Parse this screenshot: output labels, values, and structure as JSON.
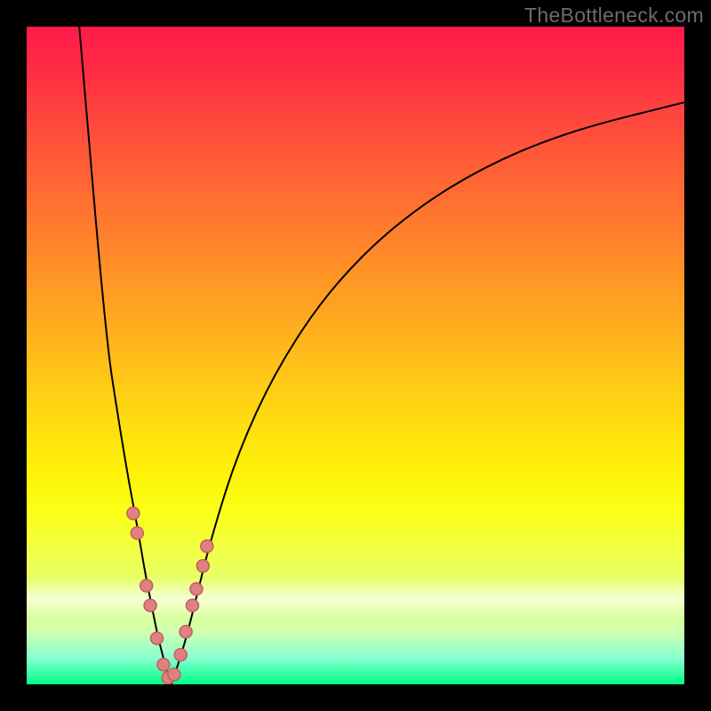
{
  "watermark": "TheBottleneck.com",
  "chart_data": {
    "type": "line",
    "title": "",
    "xlabel": "",
    "ylabel": "",
    "ylim": [
      0,
      100
    ],
    "xlim": [
      0,
      100
    ],
    "series": [
      {
        "name": "left-branch",
        "x": [
          8,
          12,
          14,
          15.5,
          17,
          18,
          19,
          20,
          20.8,
          21.4,
          22
        ],
        "values": [
          100,
          53,
          40,
          31,
          23,
          17,
          12,
          7,
          4,
          1.5,
          0
        ]
      },
      {
        "name": "right-branch",
        "x": [
          22,
          24,
          26,
          28,
          32,
          38,
          46,
          56,
          68,
          82,
          100
        ],
        "values": [
          0,
          6,
          14,
          22,
          35,
          48,
          60,
          70,
          78,
          84,
          88.5
        ]
      }
    ],
    "points": {
      "name": "highlighted-data-points",
      "x": [
        16.2,
        16.8,
        18.2,
        18.8,
        19.8,
        20.8,
        21.5,
        22.4,
        23.4,
        24.2,
        25.2,
        25.8,
        26.8,
        27.4
      ],
      "values": [
        26,
        23,
        15,
        12,
        7,
        3,
        1,
        1.5,
        4.5,
        8,
        12,
        14.5,
        18,
        21
      ]
    }
  }
}
